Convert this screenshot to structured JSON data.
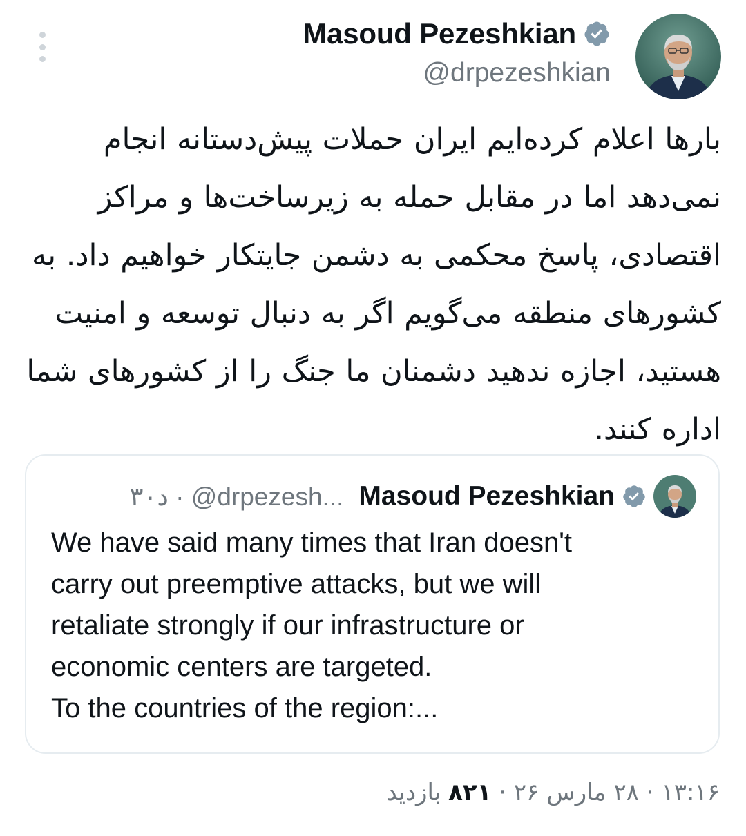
{
  "author": {
    "name": "Masoud Pezeshkian",
    "handle": "@drpezeshkian",
    "verified": true,
    "verified_color": "#829aab"
  },
  "tweet": {
    "text": "بارها اعلام کرده‌ایم ایران حملات پیش‌دستانه انجام نمی‌دهد اما در مقابل حمله به زیرساخت‌ها و مراکز اقتصادی، پاسخ محکمی به دشمن جایتکار خواهیم داد. به کشورهای منطقه می‌گویم اگر به دنبال توسعه و امنیت هستید، اجازه ندهید دشمنان ما جنگ را از کشورهای شما اداره کنند."
  },
  "quote": {
    "name": "Masoud Pezeshkian",
    "handle": "@drpezesh...",
    "separator": "·",
    "age": "۳۰د",
    "text": "We have said many times that Iran doesn't\ncarry out preemptive attacks, but we will\nretaliate strongly if our infrastructure or\neconomic centers are targeted.\nTo the countries of the region:..."
  },
  "meta": {
    "time": "۱۳:۱۶",
    "date": "۲۸ مارس ۲۶",
    "views_count": "۸۲۱",
    "views_label": "بازدید",
    "separator": "·"
  },
  "colors": {
    "text_primary": "#0f1419",
    "text_secondary": "#6e767d",
    "card_border": "#e6ecf0"
  },
  "icons": {
    "more": "more-options-icon",
    "verified": "verified-badge-icon"
  }
}
